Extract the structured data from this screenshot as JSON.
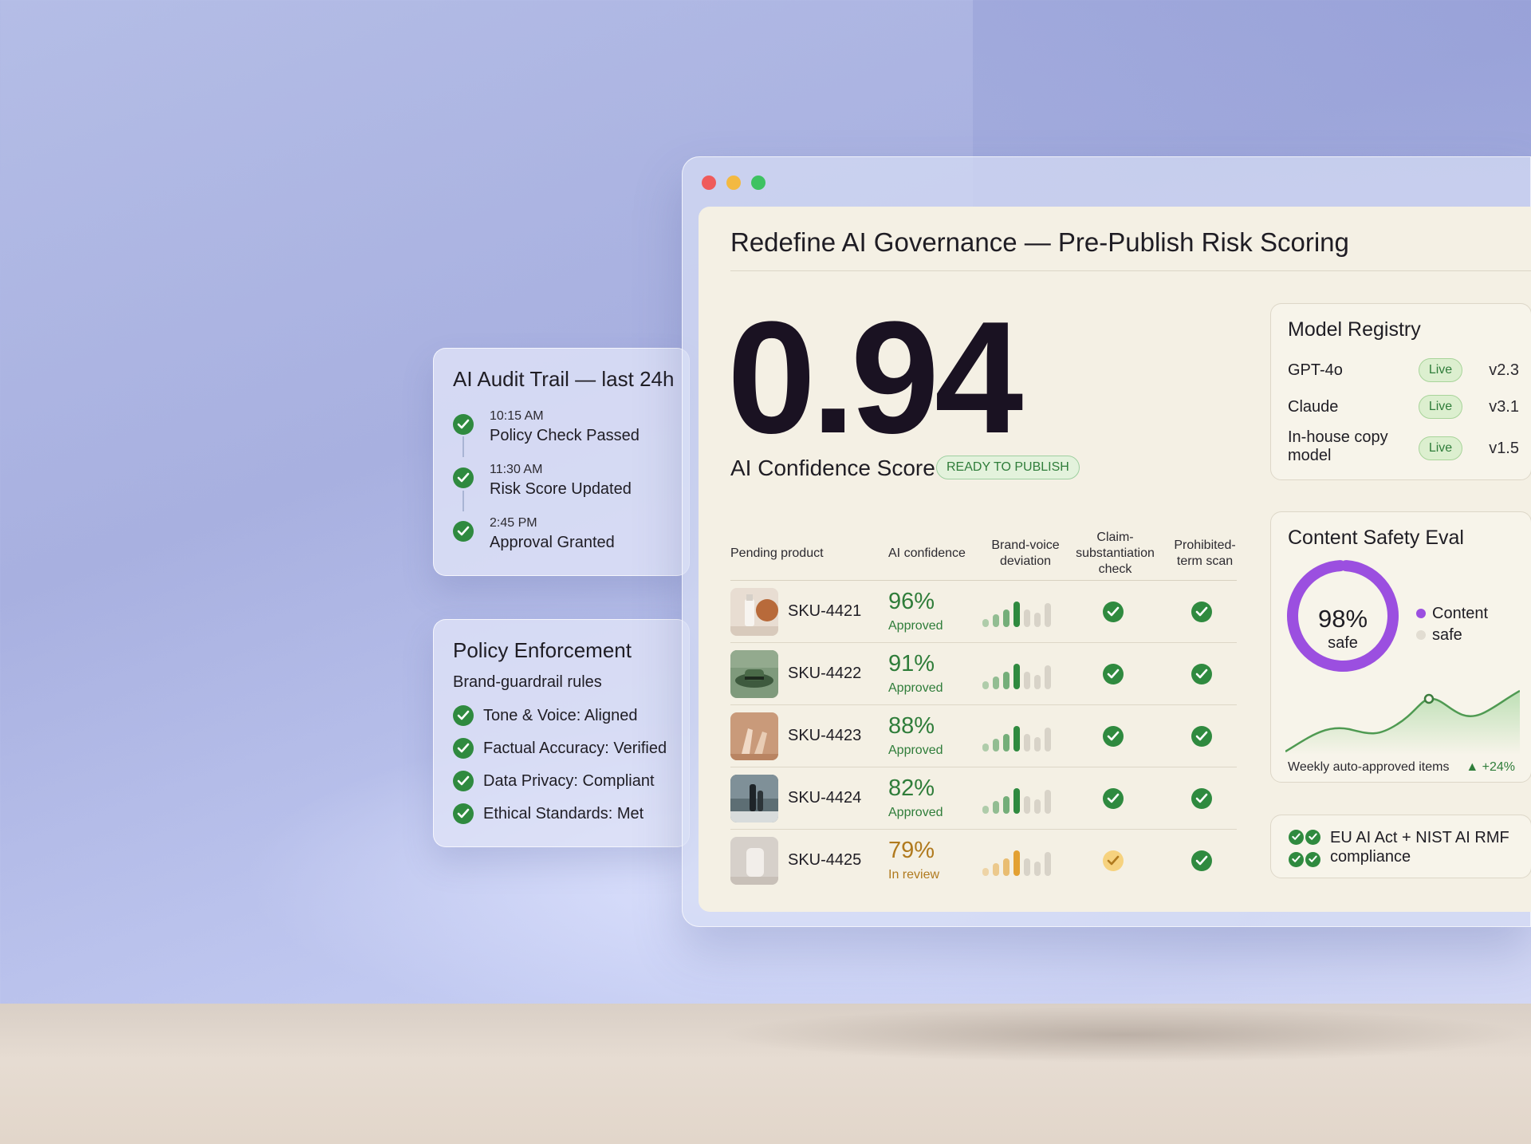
{
  "window": {
    "title": "Redefine AI Governance — Pre-Publish Risk Scoring"
  },
  "hero": {
    "score": "0.94",
    "label": "AI Confidence Score",
    "badge": "READY TO PUBLISH"
  },
  "table": {
    "headers": {
      "product": "Pending product",
      "confidence": "AI confidence",
      "brand": "Brand-voice deviation",
      "claim": "Claim-substantiation check",
      "prohibited": "Prohibited-term scan"
    },
    "rows": [
      {
        "sku": "SKU-4421",
        "confidence": "96%",
        "status": "Approved",
        "claim": "pass",
        "prohibited": "pass",
        "bar_color": "#2f8a3f"
      },
      {
        "sku": "SKU-4422",
        "confidence": "91%",
        "status": "Approved",
        "claim": "pass",
        "prohibited": "pass",
        "bar_color": "#2f8a3f"
      },
      {
        "sku": "SKU-4423",
        "confidence": "88%",
        "status": "Approved",
        "claim": "pass",
        "prohibited": "pass",
        "bar_color": "#2f8a3f"
      },
      {
        "sku": "SKU-4424",
        "confidence": "82%",
        "status": "Approved",
        "claim": "pass",
        "prohibited": "pass",
        "bar_color": "#2f8a3f"
      },
      {
        "sku": "SKU-4425",
        "confidence": "79%",
        "status": "In review",
        "claim": "warning",
        "prohibited": "pass",
        "bar_color": "#e3a133"
      }
    ]
  },
  "registry": {
    "title": "Model Registry",
    "models": [
      {
        "name": "GPT-4o",
        "status": "Live",
        "version": "v2.3"
      },
      {
        "name": "Claude",
        "status": "Live",
        "version": "v3.1"
      },
      {
        "name": "In-house copy model",
        "status": "Live",
        "version": "v1.5"
      }
    ]
  },
  "safety": {
    "title": "Content Safety Eval",
    "percent": "98%",
    "percent_value": 98,
    "sub": "safe",
    "legend": [
      "Content",
      "safe"
    ],
    "ring_color": "#9b4fe0",
    "trend_label": "Weekly auto-approved items",
    "trend_delta": "▲ +24%"
  },
  "compliance": {
    "text": "EU AI Act + NIST AI RMF compliance"
  },
  "audit": {
    "title": "AI Audit Trail — last 24h",
    "items": [
      {
        "time": "10:15 AM",
        "text": "Policy Check Passed"
      },
      {
        "time": "11:30 AM",
        "text": "Risk Score Updated"
      },
      {
        "time": "2:45 PM",
        "text": "Approval Granted"
      }
    ]
  },
  "policy": {
    "title": "Policy Enforcement",
    "subtitle": "Brand-guardrail rules",
    "items": [
      "Tone & Voice: Aligned",
      "Factual Accuracy: Verified",
      "Data Privacy: Compliant",
      "Ethical Standards: Met"
    ]
  },
  "colors": {
    "accent_green": "#2f8a3f",
    "amber": "#e3a133",
    "purple": "#9b4fe0"
  }
}
